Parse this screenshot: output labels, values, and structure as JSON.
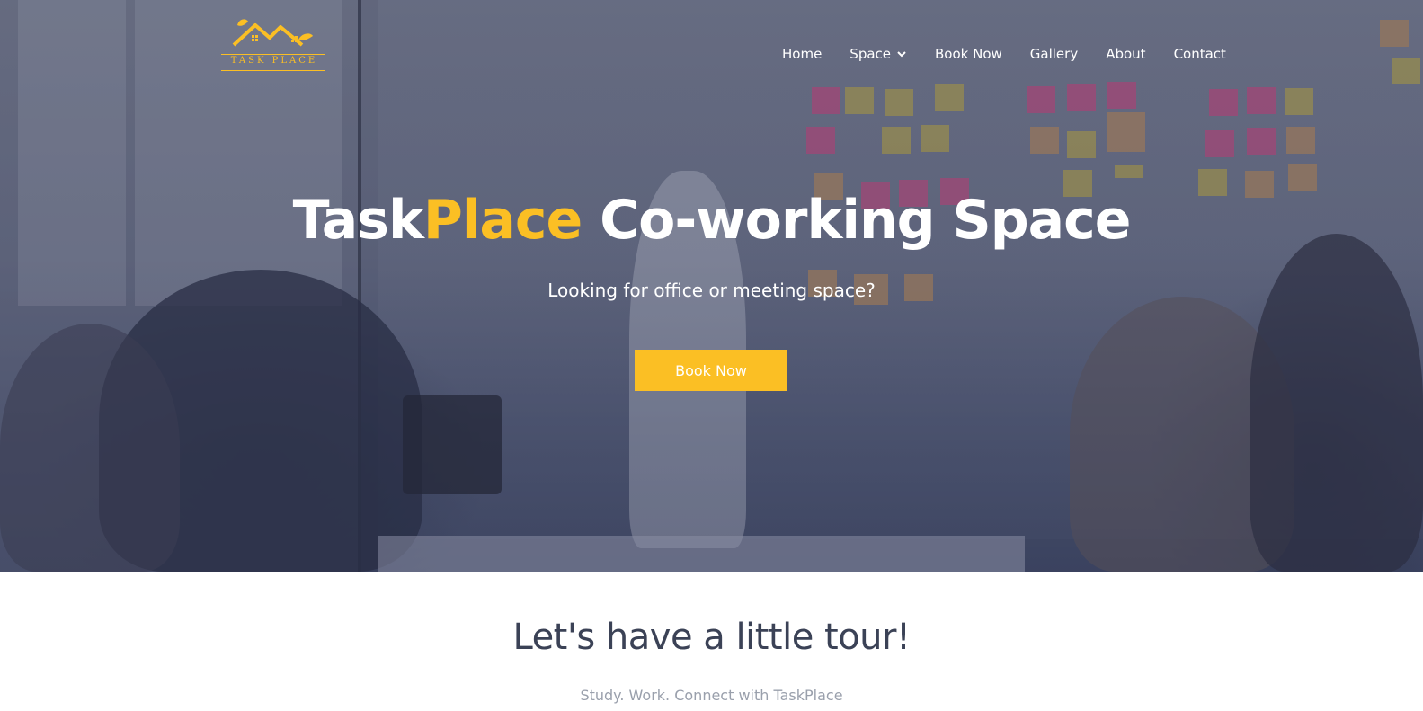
{
  "brand": {
    "logo_text": "TASK PLACE",
    "accent_color": "#fbbf24"
  },
  "nav": {
    "items": [
      {
        "label": "Home"
      },
      {
        "label": "Space",
        "icon": "chevron-down-icon"
      },
      {
        "label": "Book Now"
      },
      {
        "label": "Gallery"
      },
      {
        "label": "About"
      },
      {
        "label": "Contact"
      }
    ]
  },
  "hero": {
    "title_part1": "Task",
    "title_accent": "Place",
    "title_part2": " Co-working Space",
    "subtitle": "Looking for office or meeting space?",
    "cta_label": "Book Now"
  },
  "tour": {
    "title": "Let's have a little tour!",
    "subtitle": "Study. Work. Connect with TaskPlace"
  },
  "colors": {
    "accent": "#fbbf24",
    "heading": "#3b4256",
    "muted": "#9aa0ac"
  }
}
